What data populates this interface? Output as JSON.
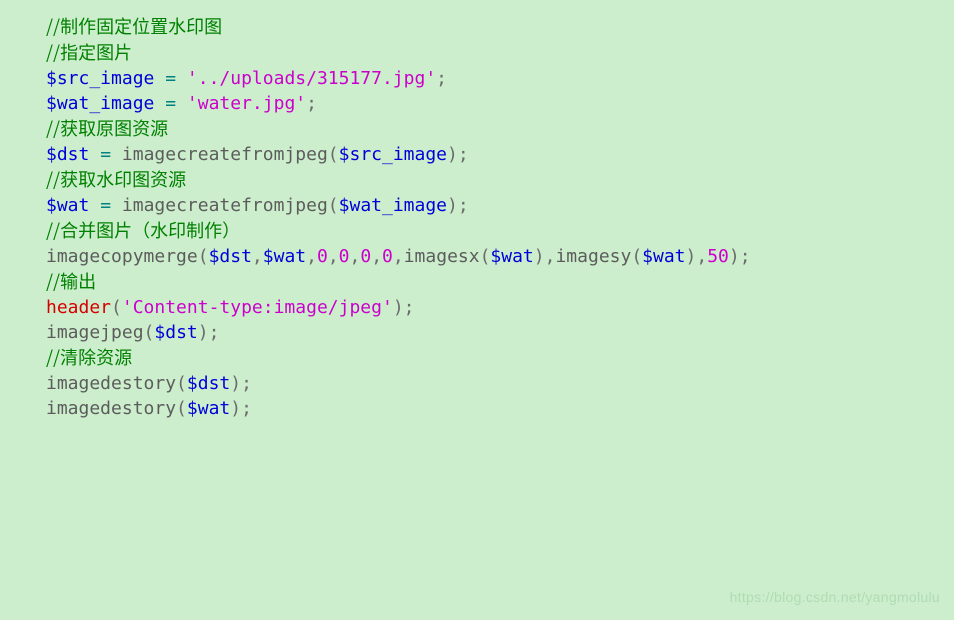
{
  "watermark": "https://blog.csdn.net/yangmolulu",
  "lines": [
    {
      "type": "comment",
      "text": "//制作固定位置水印图"
    },
    {
      "type": "blank"
    },
    {
      "type": "comment",
      "text": "//指定图片"
    },
    {
      "type": "assign",
      "var": "$src_image",
      "str": "'../uploads/315177.jpg'"
    },
    {
      "type": "assign",
      "var": "$wat_image",
      "str": "'water.jpg'"
    },
    {
      "type": "blank"
    },
    {
      "type": "comment",
      "text": "//获取原图资源"
    },
    {
      "type": "call",
      "var": "$dst",
      "fn": "imagecreatefromjpeg",
      "args": [
        {
          "t": "var",
          "v": "$src_image"
        }
      ]
    },
    {
      "type": "comment",
      "text": "//获取水印图资源"
    },
    {
      "type": "call",
      "var": "$wat",
      "fn": "imagecreatefromjpeg",
      "args": [
        {
          "t": "var",
          "v": "$wat_image"
        }
      ]
    },
    {
      "type": "blank"
    },
    {
      "type": "blank"
    },
    {
      "type": "comment",
      "text": "//合并图片（水印制作）"
    },
    {
      "type": "mergecall"
    },
    {
      "type": "blank"
    },
    {
      "type": "comment",
      "text": "//输出"
    },
    {
      "type": "header"
    },
    {
      "type": "call0",
      "fn": "imagejpeg",
      "arg": "$dst"
    },
    {
      "type": "blank"
    },
    {
      "type": "comment",
      "text": "//清除资源"
    },
    {
      "type": "call0",
      "fn": "imagedestory",
      "arg": "$dst"
    },
    {
      "type": "call0",
      "fn": "imagedestory",
      "arg": "$wat"
    }
  ],
  "merge": {
    "fn": "imagecopymerge",
    "args_prefix_vars": [
      "$dst",
      "$wat"
    ],
    "mid_nums": [
      "0",
      "0",
      "0",
      "0"
    ],
    "inner_fns": [
      "imagesx",
      "imagesy"
    ],
    "inner_arg": "$wat",
    "tail_num": "50"
  },
  "header": {
    "fn": "header",
    "str": "'Content-type:image/jpeg'"
  }
}
